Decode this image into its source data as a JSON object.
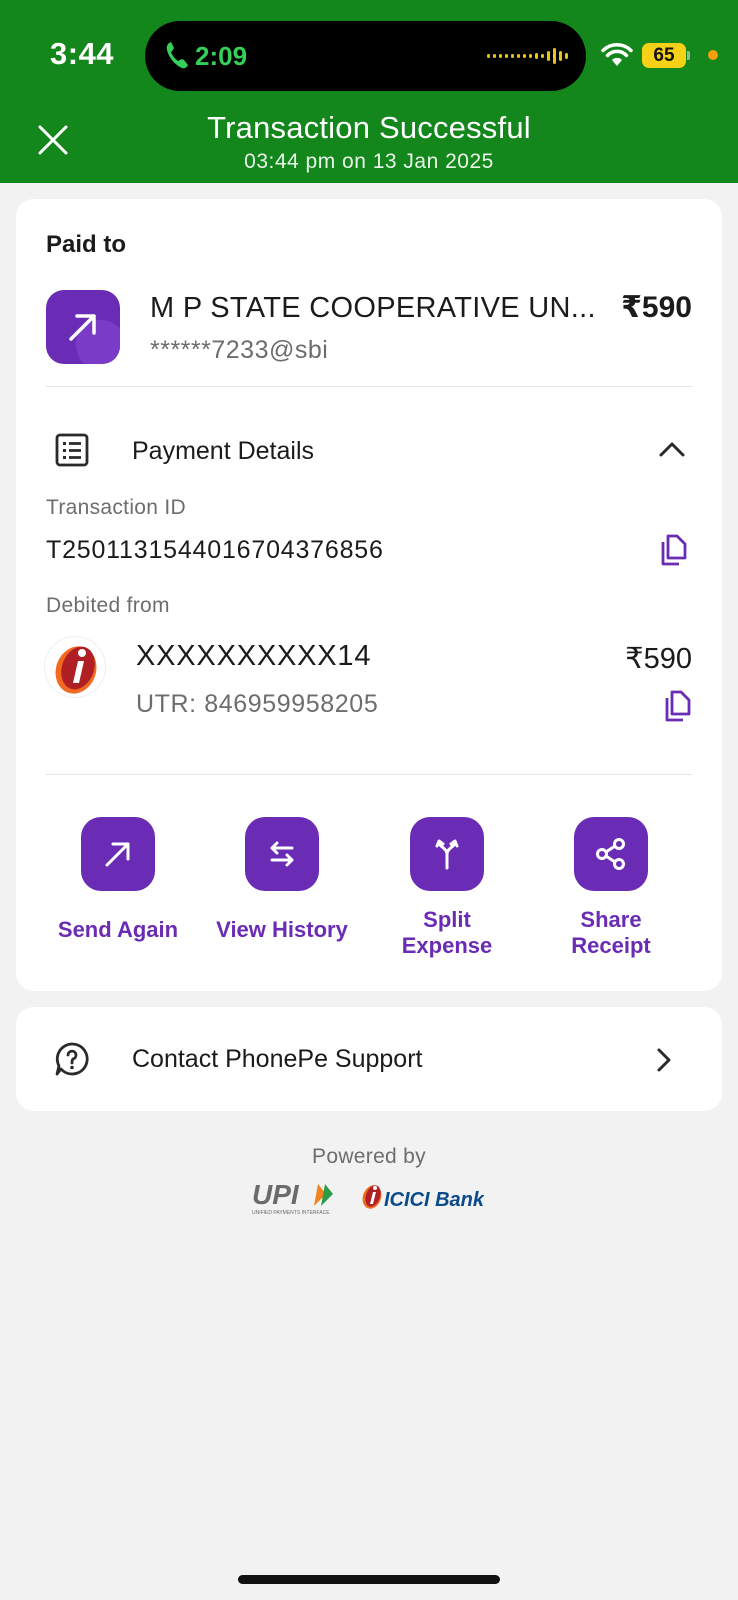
{
  "status_bar": {
    "time": "3:44",
    "call_timer": "2:09",
    "battery": "65"
  },
  "header": {
    "title": "Transaction Successful",
    "subtitle": "03:44 pm on 13 Jan 2025",
    "color": "#13871c"
  },
  "paid_to": {
    "label": "Paid to",
    "name": "M P STATE COOPERATIVE UN...",
    "upi_id": "******7233@sbi",
    "amount": "₹590"
  },
  "payment_details": {
    "label": "Payment Details",
    "expanded": true,
    "transaction_id_label": "Transaction ID",
    "transaction_id": "T2501131544016704376856",
    "debited_from_label": "Debited from",
    "account": "XXXXXXXXXX14",
    "account_amount": "₹590",
    "utr": "UTR: 846959958205"
  },
  "actions": [
    {
      "label": "Send Again",
      "icon": "arrow-up-right-icon"
    },
    {
      "label": "View History",
      "icon": "swap-arrows-icon"
    },
    {
      "label_line1": "Split",
      "label_line2": "Expense",
      "icon": "split-icon"
    },
    {
      "label_line1": "Share",
      "label_line2": "Receipt",
      "icon": "share-icon"
    }
  ],
  "support": {
    "label": "Contact PhonePe Support"
  },
  "footer": {
    "powered_by": "Powered by",
    "upi_logo_text": "UPI",
    "upi_tagline": "UNIFIED PAYMENTS INTERFACE",
    "bank_logo_text": "ICICI Bank"
  },
  "colors": {
    "accent": "#6a2bb5",
    "header_green": "#13871c",
    "background": "#f2f2f3"
  }
}
